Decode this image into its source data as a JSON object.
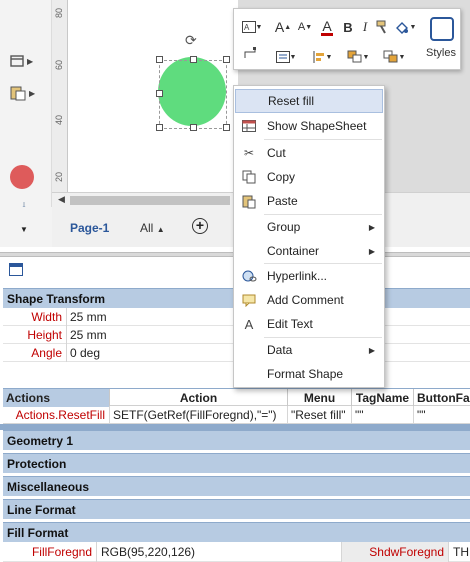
{
  "ruler": {
    "ticks": [
      "80",
      "60",
      "40",
      "20"
    ]
  },
  "page_tabs": {
    "page": "Page-1",
    "all": "All",
    "add": "+"
  },
  "mini_toolbar": {
    "font_grow": "A",
    "font_shrink": "A",
    "font_color": "A",
    "bold": "B",
    "italic": "I",
    "styles": "Styles"
  },
  "context_menu": {
    "items": [
      {
        "label": "Reset fill",
        "icon": ""
      },
      {
        "label": "Show ShapeSheet",
        "icon": "shapesheet-icon"
      },
      {
        "label": "Cut",
        "icon": "scissors-icon"
      },
      {
        "label": "Copy",
        "icon": "copy-icon"
      },
      {
        "label": "Paste",
        "icon": "paste-icon"
      },
      {
        "label": "Group",
        "icon": ""
      },
      {
        "label": "Container",
        "icon": ""
      },
      {
        "label": "Hyperlink...",
        "icon": "hyperlink-icon"
      },
      {
        "label": "Add Comment",
        "icon": "comment-icon"
      },
      {
        "label": "Edit Text",
        "icon": "text-icon"
      },
      {
        "label": "Data",
        "icon": ""
      },
      {
        "label": "Format Shape",
        "icon": ""
      }
    ]
  },
  "shapesheet": {
    "shape_transform": {
      "title": "Shape Transform",
      "rows": [
        {
          "name": "Width",
          "value": "25 mm"
        },
        {
          "name": "Height",
          "value": "25 mm"
        },
        {
          "name": "Angle",
          "value": "0 deg"
        }
      ]
    },
    "actions": {
      "headers": [
        "Actions",
        "Action",
        "Menu",
        "TagName",
        "ButtonFa"
      ],
      "row": {
        "name": "Actions.ResetFill",
        "action": "SETF(GetRef(FillForegnd),\"=\")",
        "menu": "\"Reset fill\"",
        "tagname": "\"\"",
        "buttonface": "\"\""
      }
    },
    "sections": [
      "Geometry 1",
      "Protection",
      "Miscellaneous",
      "Line Format",
      "Fill Format"
    ],
    "fill_format": {
      "name": "FillForegnd",
      "value": "RGB(95,220,126)",
      "name2": "ShdwForegnd",
      "value2": "TH"
    }
  },
  "colors": {
    "circle_fill": "#5fdc7e",
    "section_header": "#b7cbe2",
    "accent": "#2b579a",
    "cell_name": "#c00000",
    "highlight": "#dbe4f3"
  }
}
